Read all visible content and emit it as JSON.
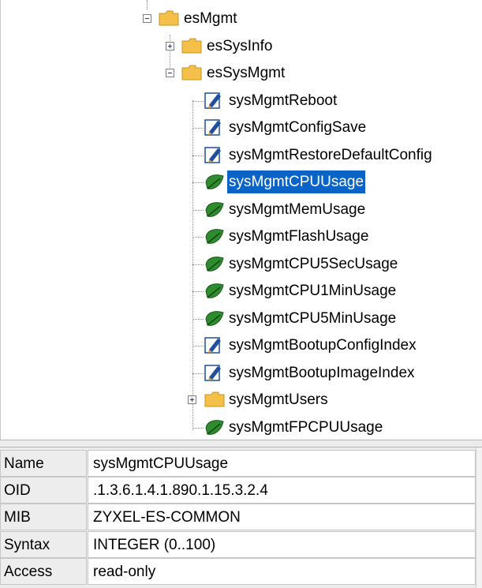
{
  "tree": {
    "nodes": [
      {
        "label": "esMgmt",
        "icon": "folder-icon",
        "toggle": "minus"
      },
      {
        "label": "esSysInfo",
        "icon": "folder-icon",
        "toggle": "plus"
      },
      {
        "label": "esSysMgmt",
        "icon": "folder-icon",
        "toggle": "minus"
      },
      {
        "label": "sysMgmtReboot",
        "icon": "writable-object-icon"
      },
      {
        "label": "sysMgmtConfigSave",
        "icon": "writable-object-icon"
      },
      {
        "label": "sysMgmtRestoreDefaultConfig",
        "icon": "writable-object-icon"
      },
      {
        "label": "sysMgmtCPUUsage",
        "icon": "leaf-icon",
        "selected": true
      },
      {
        "label": "sysMgmtMemUsage",
        "icon": "leaf-icon"
      },
      {
        "label": "sysMgmtFlashUsage",
        "icon": "leaf-icon"
      },
      {
        "label": "sysMgmtCPU5SecUsage",
        "icon": "leaf-icon"
      },
      {
        "label": "sysMgmtCPU1MinUsage",
        "icon": "leaf-icon"
      },
      {
        "label": "sysMgmtCPU5MinUsage",
        "icon": "leaf-icon"
      },
      {
        "label": "sysMgmtBootupConfigIndex",
        "icon": "writable-object-icon"
      },
      {
        "label": "sysMgmtBootupImageIndex",
        "icon": "writable-object-icon"
      },
      {
        "label": "sysMgmtUsers",
        "icon": "folder-icon",
        "toggle": "plus"
      },
      {
        "label": "sysMgmtFPCPUUsage",
        "icon": "leaf-icon"
      }
    ]
  },
  "properties": {
    "rows": [
      {
        "name": "Name",
        "value": "sysMgmtCPUUsage"
      },
      {
        "name": "OID",
        "value": ".1.3.6.1.4.1.890.1.15.3.2.4"
      },
      {
        "name": "MIB",
        "value": "ZYXEL-ES-COMMON"
      },
      {
        "name": "Syntax",
        "value": "INTEGER (0..100)"
      },
      {
        "name": "Access",
        "value": "read-only"
      }
    ]
  },
  "colors": {
    "selection": "#0a64c8",
    "folder": "#f5c04a",
    "leaf": "#2e8b2e",
    "writable": "#1f4e9c"
  }
}
